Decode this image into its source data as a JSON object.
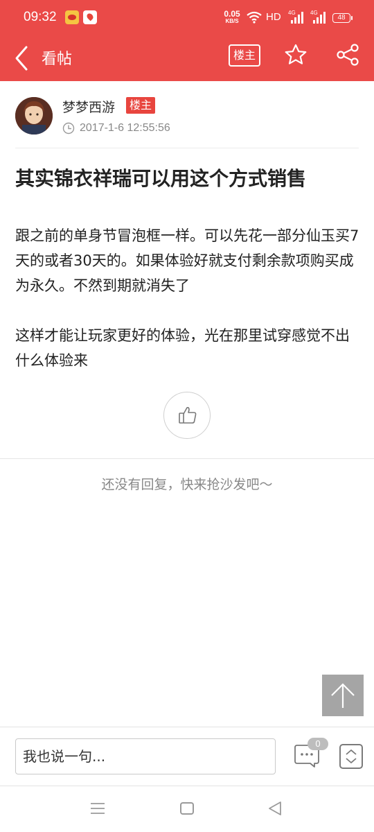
{
  "status_bar": {
    "time": "09:32",
    "net_speed_value": "0.05",
    "net_speed_unit": "KB/S",
    "hd_label": "HD",
    "signal1_label": "4G",
    "signal2_label": "4G",
    "battery_level": "48"
  },
  "navbar": {
    "title": "看帖",
    "op_filter_label": "楼主",
    "icons": [
      "back-icon",
      "star-icon",
      "share-icon"
    ]
  },
  "post": {
    "author": "梦梦西游",
    "author_badge": "楼主",
    "timestamp": "2017-1-6 12:55:56",
    "title": "其实锦衣祥瑞可以用这个方式销售",
    "paragraphs": [
      "跟之前的单身节冒泡框一样。可以先花一部分仙玉买7天的或者30天的。如果体验好就支付剩余款项购买成为永久。不然到期就消失了",
      "这样才能让玩家更好的体验，光在那里试穿感觉不出什么体验来"
    ]
  },
  "replies": {
    "empty_text": "还没有回复，快来抢沙发吧～"
  },
  "reply_bar": {
    "placeholder": "我也说一句...",
    "comment_count": "0"
  },
  "colors": {
    "brand_red": "#ea4a48",
    "badge_red": "#e8453e",
    "muted_text": "#888888"
  }
}
